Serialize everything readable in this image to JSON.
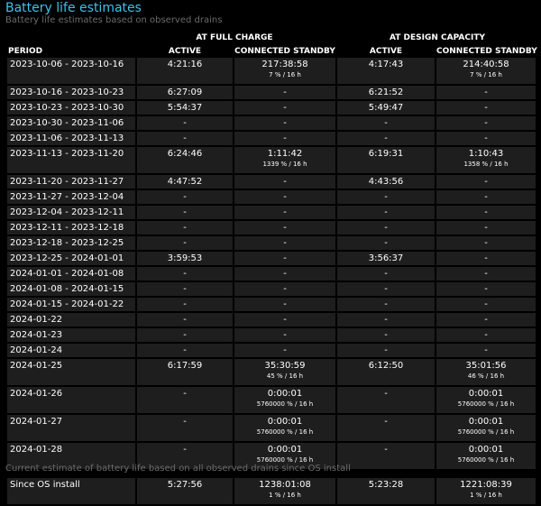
{
  "title": "Battery life estimates",
  "subtitle": "Battery life estimates based on observed drains",
  "headers": {
    "period": "PERIOD",
    "at_full_charge": "AT FULL CHARGE",
    "at_design_capacity": "AT DESIGN CAPACITY",
    "active": "ACTIVE",
    "connected_standby": "CONNECTED STANDBY"
  },
  "rows": [
    {
      "period": "2023-10-06 - 2023-10-16",
      "full_active": "4:21:16",
      "full_standby": "217:38:58",
      "full_standby_sub": "7 % / 16 h",
      "design_active": "4:17:43",
      "design_standby": "214:40:58",
      "design_standby_sub": "7 % / 16 h"
    },
    {
      "period": "2023-10-16 - 2023-10-23",
      "full_active": "6:27:09",
      "full_standby": "-",
      "full_standby_sub": "",
      "design_active": "6:21:52",
      "design_standby": "-",
      "design_standby_sub": ""
    },
    {
      "period": "2023-10-23 - 2023-10-30",
      "full_active": "5:54:37",
      "full_standby": "-",
      "full_standby_sub": "",
      "design_active": "5:49:47",
      "design_standby": "-",
      "design_standby_sub": ""
    },
    {
      "period": "2023-10-30 - 2023-11-06",
      "full_active": "-",
      "full_standby": "-",
      "full_standby_sub": "",
      "design_active": "-",
      "design_standby": "-",
      "design_standby_sub": ""
    },
    {
      "period": "2023-11-06 - 2023-11-13",
      "full_active": "-",
      "full_standby": "-",
      "full_standby_sub": "",
      "design_active": "-",
      "design_standby": "-",
      "design_standby_sub": ""
    },
    {
      "period": "2023-11-13 - 2023-11-20",
      "full_active": "6:24:46",
      "full_standby": "1:11:42",
      "full_standby_sub": "1339 % / 16 h",
      "design_active": "6:19:31",
      "design_standby": "1:10:43",
      "design_standby_sub": "1358 % / 16 h"
    },
    {
      "period": "2023-11-20 - 2023-11-27",
      "full_active": "4:47:52",
      "full_standby": "-",
      "full_standby_sub": "",
      "design_active": "4:43:56",
      "design_standby": "-",
      "design_standby_sub": ""
    },
    {
      "period": "2023-11-27 - 2023-12-04",
      "full_active": "-",
      "full_standby": "-",
      "full_standby_sub": "",
      "design_active": "-",
      "design_standby": "-",
      "design_standby_sub": ""
    },
    {
      "period": "2023-12-04 - 2023-12-11",
      "full_active": "-",
      "full_standby": "-",
      "full_standby_sub": "",
      "design_active": "-",
      "design_standby": "-",
      "design_standby_sub": ""
    },
    {
      "period": "2023-12-11 - 2023-12-18",
      "full_active": "-",
      "full_standby": "-",
      "full_standby_sub": "",
      "design_active": "-",
      "design_standby": "-",
      "design_standby_sub": ""
    },
    {
      "period": "2023-12-18 - 2023-12-25",
      "full_active": "-",
      "full_standby": "-",
      "full_standby_sub": "",
      "design_active": "-",
      "design_standby": "-",
      "design_standby_sub": ""
    },
    {
      "period": "2023-12-25 - 2024-01-01",
      "full_active": "3:59:53",
      "full_standby": "-",
      "full_standby_sub": "",
      "design_active": "3:56:37",
      "design_standby": "-",
      "design_standby_sub": ""
    },
    {
      "period": "2024-01-01 - 2024-01-08",
      "full_active": "-",
      "full_standby": "-",
      "full_standby_sub": "",
      "design_active": "-",
      "design_standby": "-",
      "design_standby_sub": ""
    },
    {
      "period": "2024-01-08 - 2024-01-15",
      "full_active": "-",
      "full_standby": "-",
      "full_standby_sub": "",
      "design_active": "-",
      "design_standby": "-",
      "design_standby_sub": ""
    },
    {
      "period": "2024-01-15 - 2024-01-22",
      "full_active": "-",
      "full_standby": "-",
      "full_standby_sub": "",
      "design_active": "-",
      "design_standby": "-",
      "design_standby_sub": ""
    },
    {
      "period": "2024-01-22",
      "full_active": "-",
      "full_standby": "-",
      "full_standby_sub": "",
      "design_active": "-",
      "design_standby": "-",
      "design_standby_sub": ""
    },
    {
      "period": "2024-01-23",
      "full_active": "-",
      "full_standby": "-",
      "full_standby_sub": "",
      "design_active": "-",
      "design_standby": "-",
      "design_standby_sub": ""
    },
    {
      "period": "2024-01-24",
      "full_active": "-",
      "full_standby": "-",
      "full_standby_sub": "",
      "design_active": "-",
      "design_standby": "-",
      "design_standby_sub": ""
    },
    {
      "period": "2024-01-25",
      "full_active": "6:17:59",
      "full_standby": "35:30:59",
      "full_standby_sub": "45 % / 16 h",
      "design_active": "6:12:50",
      "design_standby": "35:01:56",
      "design_standby_sub": "46 % / 16 h"
    },
    {
      "period": "2024-01-26",
      "full_active": "-",
      "full_standby": "0:00:01",
      "full_standby_sub": "5760000 % / 16 h",
      "design_active": "-",
      "design_standby": "0:00:01",
      "design_standby_sub": "5760000 % / 16 h"
    },
    {
      "period": "2024-01-27",
      "full_active": "-",
      "full_standby": "0:00:01",
      "full_standby_sub": "5760000 % / 16 h",
      "design_active": "-",
      "design_standby": "0:00:01",
      "design_standby_sub": "5760000 % / 16 h"
    },
    {
      "period": "2024-01-28",
      "full_active": "-",
      "full_standby": "0:00:01",
      "full_standby_sub": "5760000 % / 16 h",
      "design_active": "-",
      "design_standby": "0:00:01",
      "design_standby_sub": "5760000 % / 16 h"
    }
  ],
  "current_estimate_label": "Current estimate of battery life based on all observed drains since OS install",
  "since_install": {
    "period": "Since OS install",
    "full_active": "5:27:56",
    "full_standby": "1238:01:08",
    "full_standby_sub": "1 % / 16 h",
    "design_active": "5:23:28",
    "design_standby": "1221:08:39",
    "design_standby_sub": "1 % / 16 h"
  },
  "colors": {
    "background": "#000000",
    "title": "#3dc2ec",
    "subtitle": "#6b6b6b",
    "cell": "#1e1e1e",
    "text": "#ffffff"
  }
}
